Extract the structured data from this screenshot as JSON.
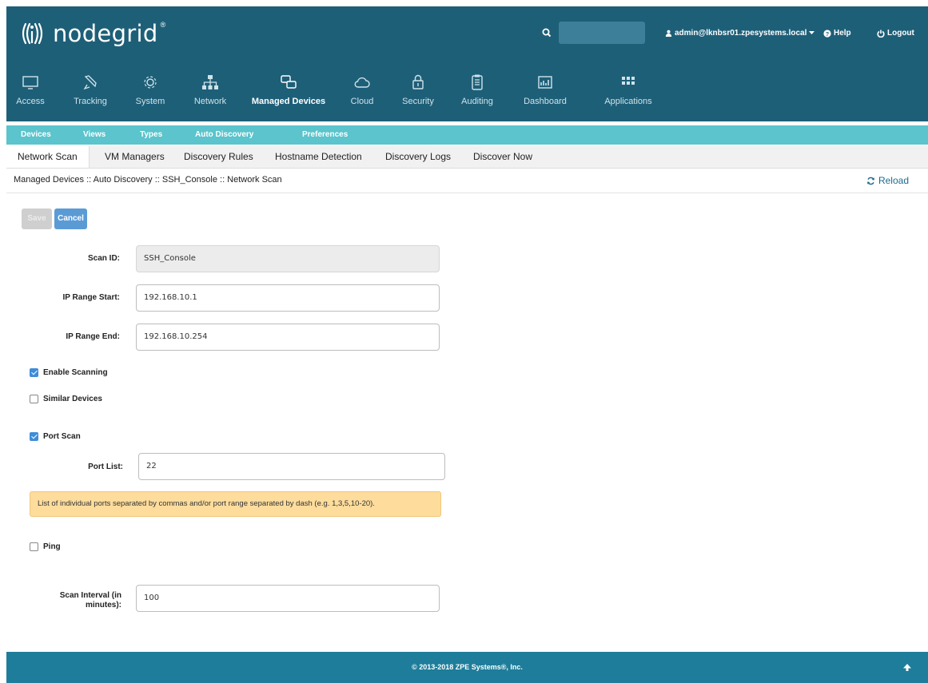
{
  "brand": {
    "name": "nodegrid",
    "reg": "®"
  },
  "header": {
    "user": "admin@lknbsr01.zpesystems.local",
    "help": "Help",
    "logout": "Logout"
  },
  "nav": [
    {
      "label": "Access",
      "icon": "monitor-icon"
    },
    {
      "label": "Tracking",
      "icon": "satellite-icon"
    },
    {
      "label": "System",
      "icon": "gear-icon"
    },
    {
      "label": "Network",
      "icon": "network-icon"
    },
    {
      "label": "Managed Devices",
      "icon": "devices-icon"
    },
    {
      "label": "Cloud",
      "icon": "cloud-icon"
    },
    {
      "label": "Security",
      "icon": "lock-icon"
    },
    {
      "label": "Auditing",
      "icon": "clipboard-icon"
    },
    {
      "label": "Dashboard",
      "icon": "chart-icon"
    },
    {
      "label": "Applications",
      "icon": "grid-icon"
    }
  ],
  "subtabs": [
    "Devices",
    "Views",
    "Types",
    "Auto Discovery",
    "Preferences"
  ],
  "tabs": [
    "Network Scan",
    "VM Managers",
    "Discovery Rules",
    "Hostname Detection",
    "Discovery Logs",
    "Discover Now"
  ],
  "breadcrumb": "Managed Devices :: Auto Discovery :: SSH_Console :: Network Scan",
  "reload": "Reload",
  "buttons": {
    "save": "Save",
    "cancel": "Cancel"
  },
  "form": {
    "scan_id_label": "Scan ID:",
    "scan_id_value": "SSH_Console",
    "ip_start_label": "IP Range Start:",
    "ip_start_value": "192.168.10.1",
    "ip_end_label": "IP Range End:",
    "ip_end_value": "192.168.10.254",
    "enable_scanning": "Enable Scanning",
    "similar_devices": "Similar Devices",
    "port_scan": "Port Scan",
    "port_list_label": "Port List:",
    "port_list_value": "22",
    "port_hint": "List of individual ports separated by commas and/or port range separated by dash (e.g. 1,3,5,10-20).",
    "ping": "Ping",
    "interval_label_1": "Scan Interval (in",
    "interval_label_2": "minutes):",
    "interval_value": "100"
  },
  "checks": {
    "enable_scanning": true,
    "similar_devices": false,
    "port_scan": true,
    "ping": false
  },
  "footer": {
    "text": "© 2013-2018 ZPE Systems®, Inc."
  },
  "colors": {
    "header": "#1e5f78",
    "subtabs": "#5bc4cc",
    "footer": "#1e7d9a",
    "hint": "#fddc9c",
    "accent": "#3f8cd8"
  }
}
